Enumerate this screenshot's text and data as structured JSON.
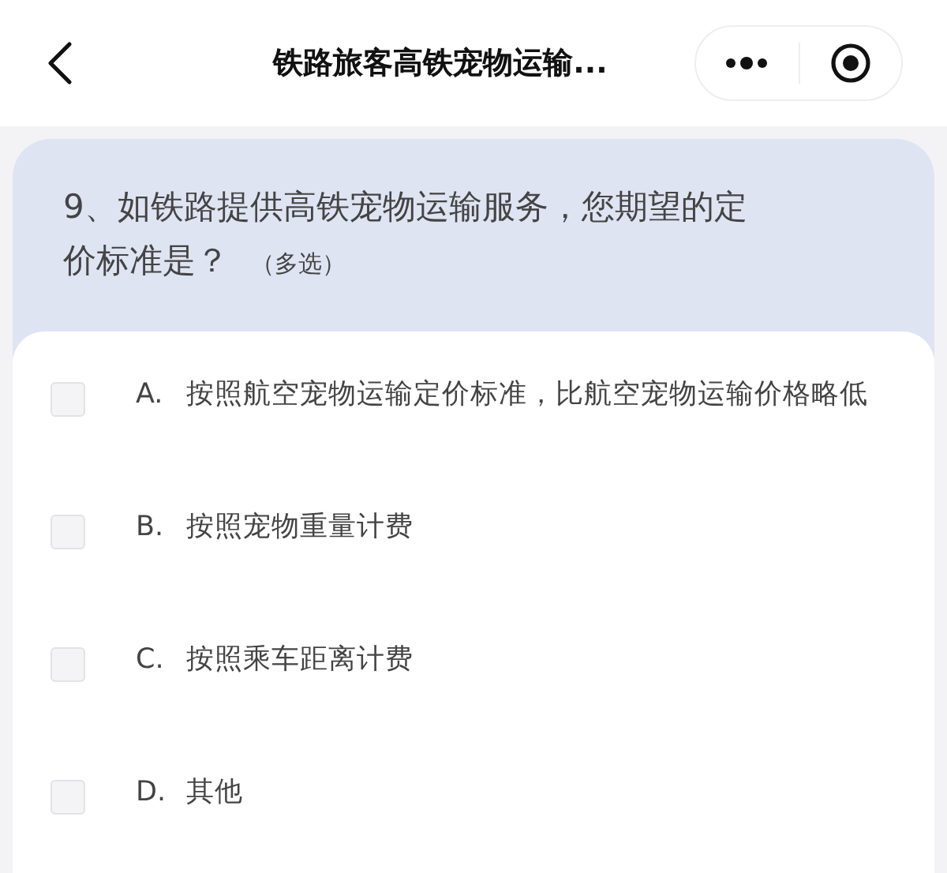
{
  "header": {
    "title": "铁路旅客高铁宠物运输..."
  },
  "question": {
    "number": "9、",
    "text": "如铁路提供高铁宠物运输服务，您期望的定价标准是？",
    "hint": "（多选）"
  },
  "options": [
    {
      "letter": "A.",
      "text": "按照航空宠物运输定价标准，比航空宠物运输价格略低",
      "checked": false
    },
    {
      "letter": "B.",
      "text": "按照宠物重量计费",
      "checked": false
    },
    {
      "letter": "C.",
      "text": "按照乘车距离计费",
      "checked": false
    },
    {
      "letter": "D.",
      "text": "其他",
      "checked": false
    }
  ]
}
